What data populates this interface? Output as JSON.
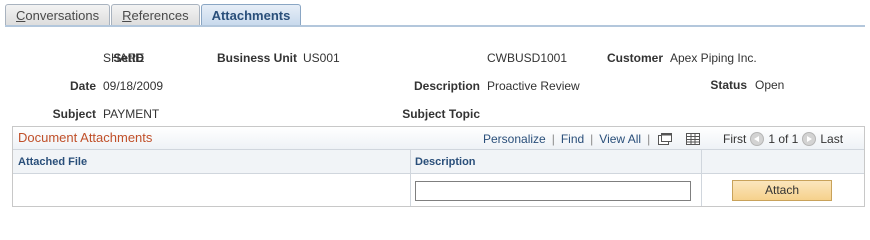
{
  "tabs": [
    {
      "label_first": "C",
      "label_rest": "onversations"
    },
    {
      "label_first": "R",
      "label_rest": "eferences"
    },
    {
      "label": "Attachments"
    }
  ],
  "fields": {
    "setid_label": "SetID",
    "setid_value": "SHARE",
    "bu_label": "Business Unit",
    "bu_value": "US001",
    "bu_extra": "CWBUSD1001",
    "customer_label": "Customer",
    "customer_value": "Apex Piping Inc.",
    "date_label": "Date",
    "date_value": "09/18/2009",
    "desc_label": "Description",
    "desc_value": "Proactive Review",
    "status_label": "Status",
    "status_value": "Open",
    "subject_label": "Subject",
    "subject_value": "PAYMENT",
    "topic_label": "Subject Topic"
  },
  "grid": {
    "title": "Document Attachments",
    "personalize": "Personalize",
    "find": "Find",
    "view_all": "View All",
    "sep": "|",
    "first": "First",
    "page_info": "1 of 1",
    "last": "Last",
    "columns": [
      "Attached File",
      "Description",
      ""
    ],
    "row": {
      "description_value": "",
      "attach_label": "Attach"
    }
  }
}
